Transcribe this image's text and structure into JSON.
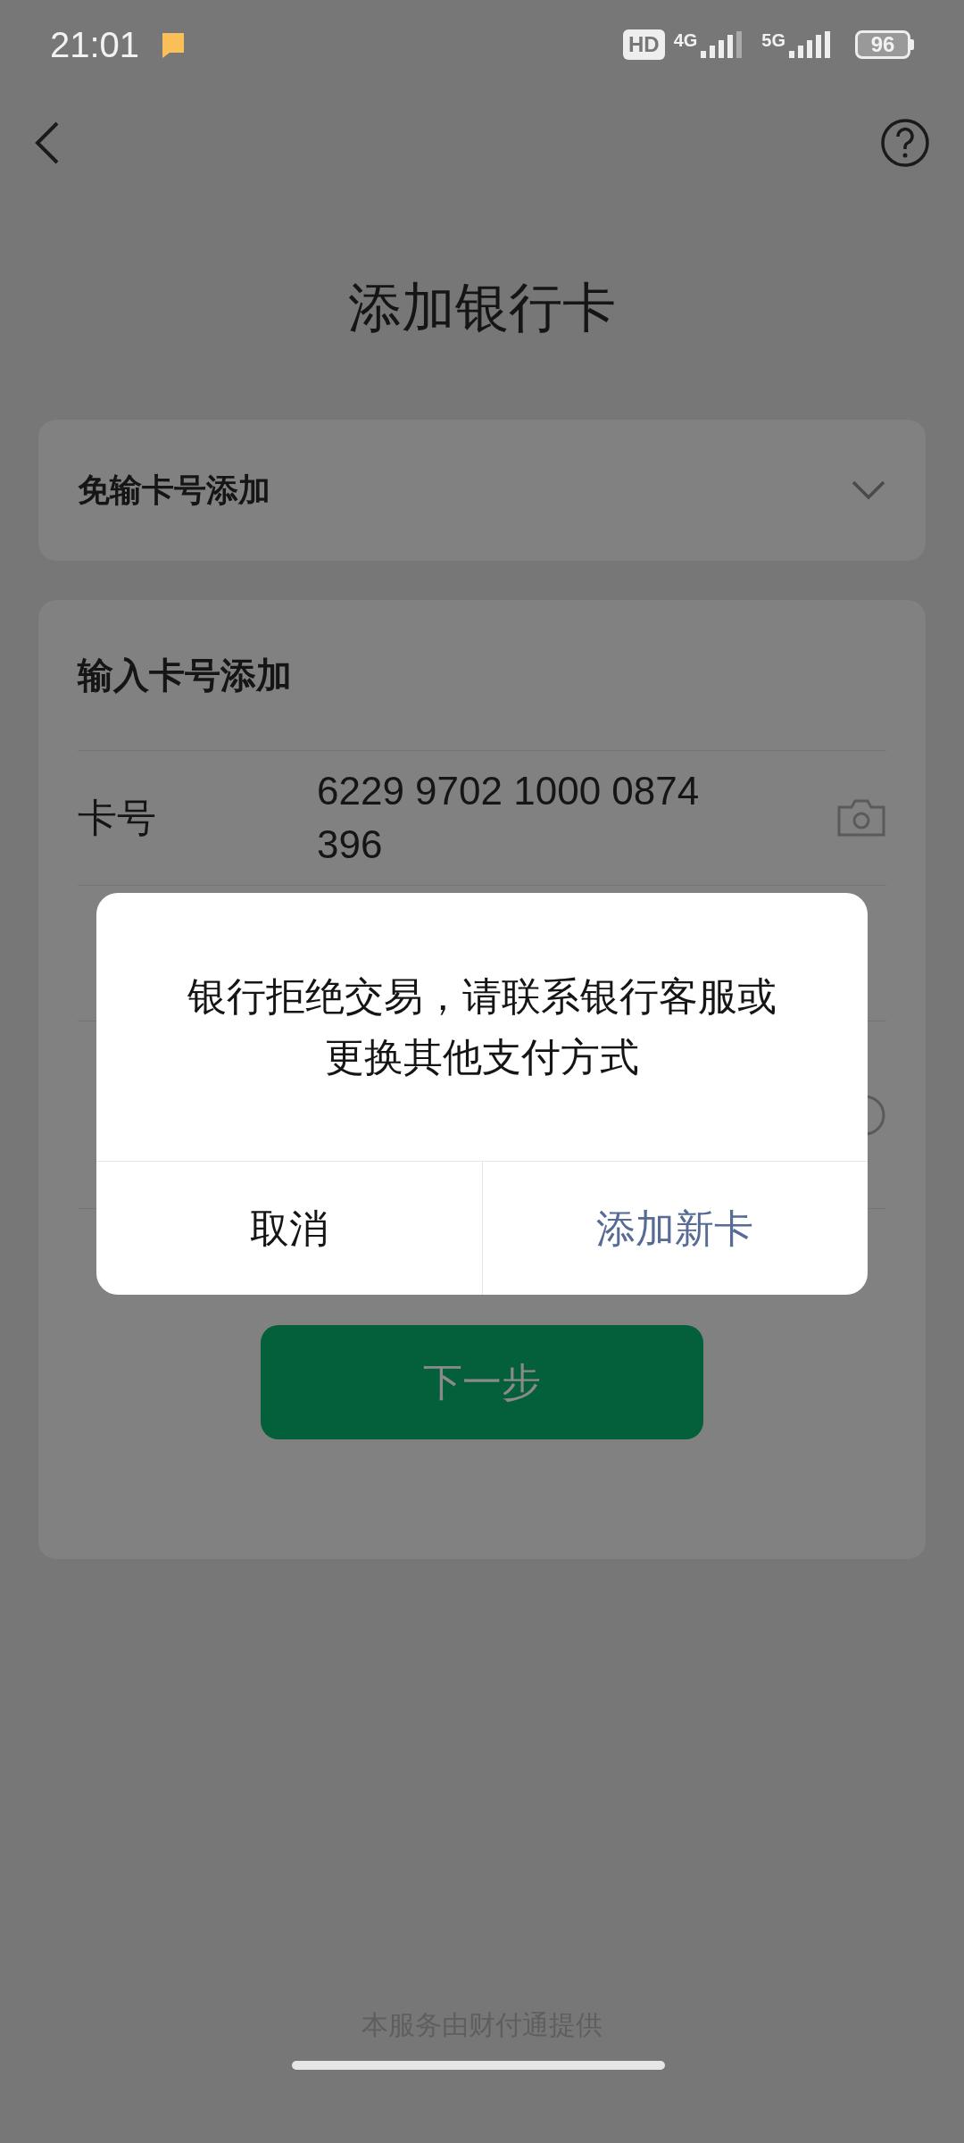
{
  "status_bar": {
    "time": "21:01",
    "hd_badge": "HD",
    "sim_1_network": "4G",
    "sim_2_network": "5G",
    "battery": "96"
  },
  "header": {
    "title": "添加银行卡"
  },
  "quick_add": {
    "label": "免输卡号添加",
    "expanded": false
  },
  "manual_add": {
    "heading": "输入卡号添加",
    "card_number": {
      "label": "卡号",
      "value": "6229 9702 1000 0874 396"
    }
  },
  "next_button": {
    "label": "下一步",
    "disabled": true
  },
  "footer": "本服务由财付通提供",
  "dialog": {
    "message_lines": [
      "银行拒绝交易，请联系银行客服或",
      "更换其他支付方式"
    ],
    "buttons": [
      {
        "label": "取消",
        "kind": "cancel"
      },
      {
        "label": "添加新卡",
        "kind": "confirm"
      }
    ]
  }
}
